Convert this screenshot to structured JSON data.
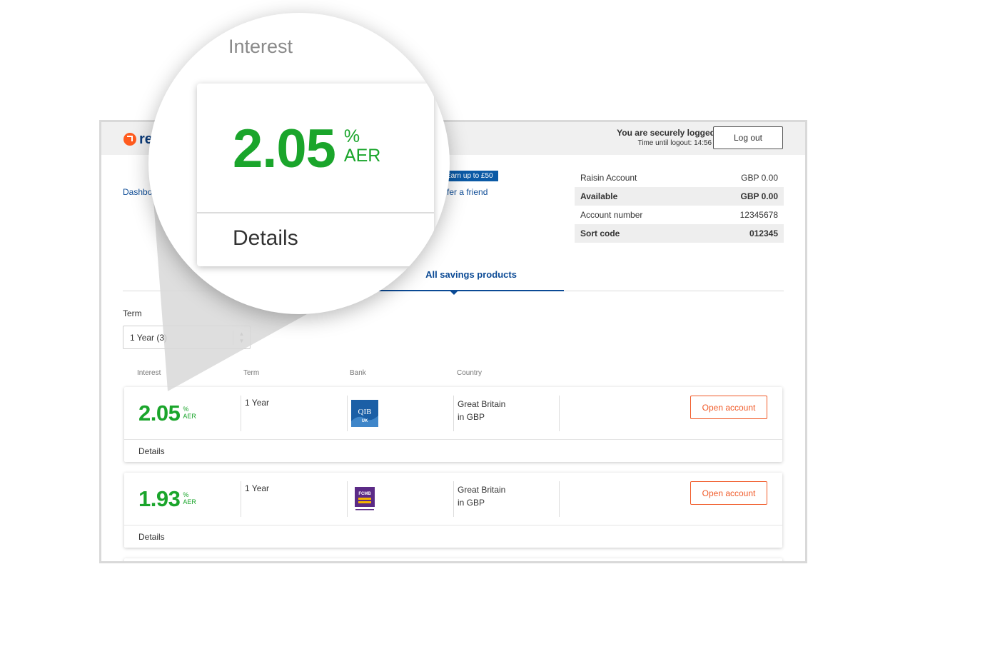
{
  "header": {
    "logo_text": "re",
    "login_title": "You are securely logged in",
    "login_time": "Time until logout: 14:56 min",
    "logout_label": "Log out"
  },
  "nav": {
    "dashboard": "Dashbo",
    "promo_badge": "Earn up to £50",
    "refer_link": "fer a friend"
  },
  "account": {
    "rows": [
      {
        "label": "Raisin Account",
        "value": "GBP 0.00"
      },
      {
        "label": "Available",
        "value": "GBP 0.00"
      },
      {
        "label": "Account number",
        "value": "12345678"
      },
      {
        "label": "Sort code",
        "value": "012345"
      }
    ]
  },
  "tabs": {
    "active": "All savings products"
  },
  "filter": {
    "term_label": "Term",
    "term_value": "1 Year (3)"
  },
  "columns": {
    "interest": "Interest",
    "term": "Term",
    "bank": "Bank",
    "country": "Country"
  },
  "products": [
    {
      "rate": "2.05",
      "percent": "%",
      "aer": "AER",
      "term": "1 Year",
      "bank_logo": "qib-uk-logo",
      "bank_logo_text": "QIB",
      "bank_logo_sub": "UK",
      "country_line1": "Great Britain",
      "country_line2": "in GBP",
      "open_label": "Open account",
      "details_label": "Details"
    },
    {
      "rate": "1.93",
      "percent": "%",
      "aer": "AER",
      "term": "1 Year",
      "bank_logo": "fcmb-logo",
      "bank_logo_text": "FCMB",
      "country_line1": "Great Britain",
      "country_line2": "in GBP",
      "open_label": "Open account",
      "details_label": "Details"
    }
  ],
  "magnifier": {
    "title": "Interest",
    "rate": "2.05",
    "percent": "%",
    "aer": "AER",
    "details_label": "Details"
  },
  "colors": {
    "rate_green": "#1aa52b",
    "brand_blue": "#0b4a95",
    "cta_orange": "#f05a28"
  }
}
